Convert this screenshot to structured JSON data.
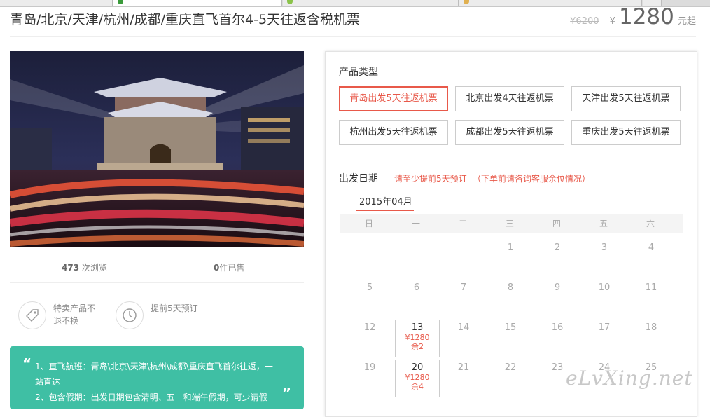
{
  "product": {
    "title": "青岛/北京/天津/杭州/成都/重庆直飞首尔4-5天往返含税机票",
    "old_price": "¥6200",
    "currency": "¥",
    "price": "1280",
    "price_unit": "元起"
  },
  "stats": {
    "views_num": "473",
    "views_label": " 次浏览",
    "sold_num": "0",
    "sold_label": "件已售"
  },
  "features": [
    {
      "icon": "tag-icon",
      "text": "特卖产品不退不换"
    },
    {
      "icon": "clock-icon",
      "text": "提前5天预订"
    }
  ],
  "highlights": {
    "line1": "1、直飞航班：青岛\\北京\\天津\\杭州\\成都\\重庆直飞首尔往返，一站直达",
    "line2": "2、包含假期：出发日期包含清明、五一和端午假期，可少请假"
  },
  "product_type": {
    "label": "产品类型",
    "options": [
      "青岛出发5天往返机票",
      "北京出发4天往返机票",
      "天津出发5天往返机票",
      "杭州出发5天往返机票",
      "成都出发5天往返机票",
      "重庆出发5天往返机票"
    ],
    "selected_index": 0
  },
  "departure": {
    "label": "出发日期",
    "notice1": "请至少提前5天预订",
    "notice2": "（下单前请咨询客服余位情况）",
    "month": "2015年04月",
    "weekdays": [
      "日",
      "一",
      "二",
      "三",
      "四",
      "五",
      "六"
    ],
    "rows": [
      [
        "",
        "",
        "",
        "1",
        "2",
        "3",
        "4"
      ],
      [
        "5",
        "6",
        "7",
        "8",
        "9",
        "10",
        "11"
      ],
      [
        "12",
        "13",
        "14",
        "15",
        "16",
        "17",
        "18"
      ],
      [
        "19",
        "20",
        "21",
        "22",
        "23",
        "24",
        "25"
      ]
    ],
    "available": [
      {
        "day": "13",
        "price": "¥1280",
        "left": "余2"
      },
      {
        "day": "20",
        "price": "¥1280",
        "left": "余4"
      }
    ]
  },
  "watermark": "eLvXing.net",
  "colors": {
    "accent": "#e8594a",
    "green": "#3fbfa4"
  }
}
